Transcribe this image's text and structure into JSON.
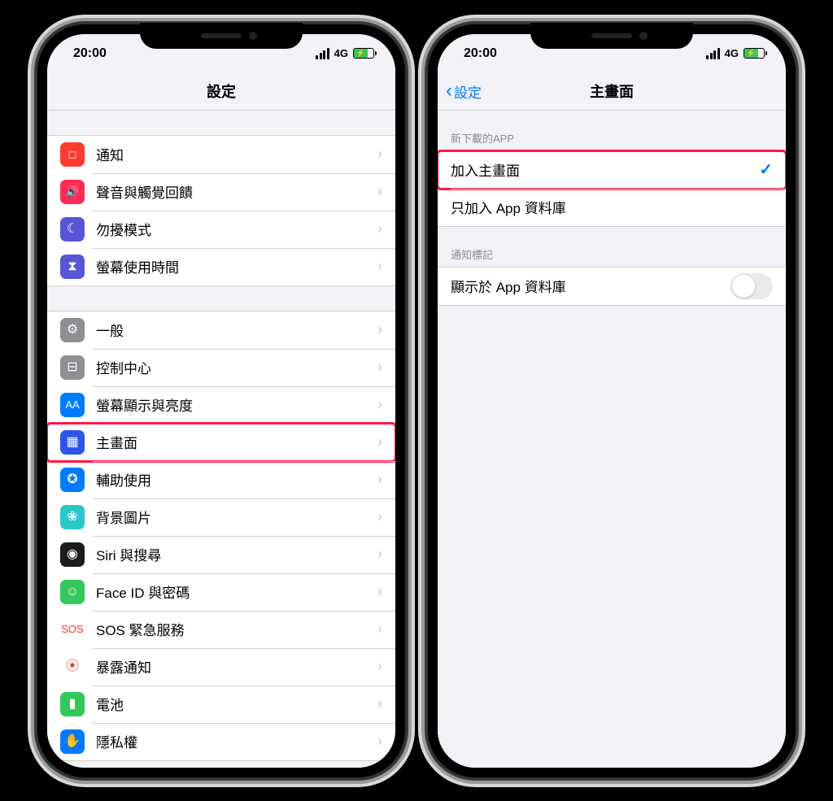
{
  "status": {
    "time": "20:00",
    "network": "4G"
  },
  "left": {
    "nav_title": "設定",
    "group1": [
      {
        "key": "notifications",
        "label": "通知",
        "icon_bg": "#ff3b30",
        "glyph": "◻︎"
      },
      {
        "key": "sounds",
        "label": "聲音與觸覺回饋",
        "icon_bg": "#ff2d55",
        "glyph": "🔊"
      },
      {
        "key": "dnd",
        "label": "勿擾模式",
        "icon_bg": "#5856d6",
        "glyph": "☾"
      },
      {
        "key": "screentime",
        "label": "螢幕使用時間",
        "icon_bg": "#5856d6",
        "glyph": "⧗"
      }
    ],
    "group2": [
      {
        "key": "general",
        "label": "一般",
        "icon_bg": "#8e8e93",
        "glyph": "⚙"
      },
      {
        "key": "control",
        "label": "控制中心",
        "icon_bg": "#8e8e93",
        "glyph": "⊟"
      },
      {
        "key": "display",
        "label": "螢幕顯示與亮度",
        "icon_bg": "#007aff",
        "glyph": "AA"
      },
      {
        "key": "homescreen",
        "label": "主畫面",
        "icon_bg": "#2f54eb",
        "glyph": "▦",
        "highlight": true
      },
      {
        "key": "accessibility",
        "label": "輔助使用",
        "icon_bg": "#007aff",
        "glyph": "✪"
      },
      {
        "key": "wallpaper",
        "label": "背景圖片",
        "icon_bg": "#28c8c8",
        "glyph": "❀"
      },
      {
        "key": "siri",
        "label": "Siri 與搜尋",
        "icon_bg": "#1c1c1e",
        "glyph": "◉"
      },
      {
        "key": "faceid",
        "label": "Face ID 與密碼",
        "icon_bg": "#34c759",
        "glyph": "☺"
      },
      {
        "key": "sos",
        "label": "SOS 緊急服務",
        "icon_bg": "#ffffff",
        "glyph": "SOS",
        "text_color": "#ff3b30"
      },
      {
        "key": "exposure",
        "label": "暴露通知",
        "icon_bg": "#ffffff",
        "glyph": "⦿",
        "text_color": "#ff3b30"
      },
      {
        "key": "battery",
        "label": "電池",
        "icon_bg": "#34c759",
        "glyph": "▮"
      },
      {
        "key": "privacy",
        "label": "隱私權",
        "icon_bg": "#007aff",
        "glyph": "✋"
      }
    ]
  },
  "right": {
    "back_label": "設定",
    "nav_title": "主畫面",
    "section1_header": "新下載的APP",
    "section1": [
      {
        "key": "addhome",
        "label": "加入主畫面",
        "checked": true,
        "highlight": true
      },
      {
        "key": "addlib",
        "label": "只加入 App 資料庫",
        "checked": false
      }
    ],
    "section2_header": "通知標記",
    "section2_row": {
      "key": "showinlib",
      "label": "顯示於 App 資料庫",
      "on": false
    }
  }
}
